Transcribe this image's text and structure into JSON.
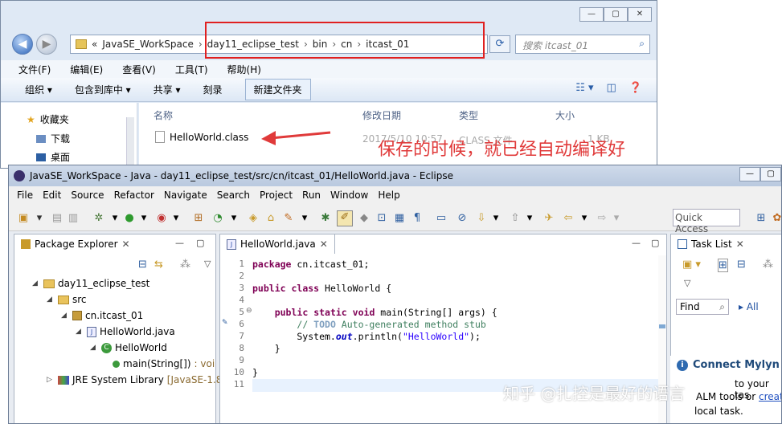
{
  "explorer": {
    "breadcrumb": [
      "JavaSE_WorkSpace",
      "day11_eclipse_test",
      "bin",
      "cn",
      "itcast_01"
    ],
    "breadcrumb_prefix": "«",
    "search_placeholder": "搜索 itcast_01",
    "menu": [
      "文件(F)",
      "编辑(E)",
      "查看(V)",
      "工具(T)",
      "帮助(H)"
    ],
    "toolbar": [
      "组织 ▾",
      "包含到库中 ▾",
      "共享 ▾",
      "刻录",
      "新建文件夹"
    ],
    "nav": [
      "收藏夹",
      "下载",
      "桌面"
    ],
    "columns": [
      "名称",
      "修改日期",
      "类型",
      "大小"
    ],
    "file": {
      "name": "HelloWorld.class",
      "date": "2017/5/10 10:57",
      "type": "CLASS 文件",
      "size": "1 KB"
    },
    "annotation": "保存的时候，就已经自动编译好"
  },
  "eclipse": {
    "title": "JavaSE_WorkSpace - Java - day11_eclipse_test/src/cn/itcast_01/HelloWorld.java - Eclipse",
    "menu": [
      "File",
      "Edit",
      "Source",
      "Refactor",
      "Navigate",
      "Search",
      "Project",
      "Run",
      "Window",
      "Help"
    ],
    "quick_access": "Quick Access",
    "package_explorer": {
      "tab": "Package Explorer",
      "tree": [
        {
          "label": "day11_eclipse_test",
          "extra": ""
        },
        {
          "label": "src",
          "extra": ""
        },
        {
          "label": "cn.itcast_01",
          "extra": ""
        },
        {
          "label": "HelloWorld.java",
          "extra": ""
        },
        {
          "label": "HelloWorld",
          "extra": ""
        },
        {
          "label": "main(String[])",
          "extra": ": voi"
        },
        {
          "label": "JRE System Library",
          "extra": "[JavaSE-1.8]"
        }
      ]
    },
    "editor": {
      "tab": "HelloWorld.java",
      "line_numbers": [
        "1",
        "2",
        "3",
        "4",
        "5",
        "6",
        "7",
        "8",
        "9",
        "10",
        "11"
      ]
    },
    "task_list": {
      "tab": "Task List",
      "find": "Find",
      "all": "All"
    },
    "mylyn": {
      "title": "Connect Mylyn",
      "text1": "to your tas",
      "text2": "ALM tools or",
      "link": "creat",
      "text3": "local task."
    }
  },
  "watermark": "知乎 @扎控是最好的语言"
}
